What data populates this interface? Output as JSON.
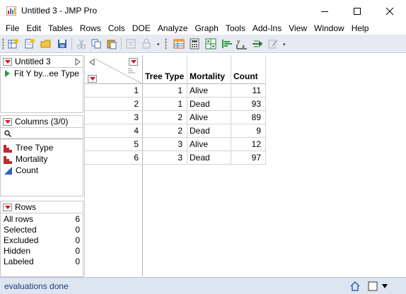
{
  "window": {
    "title": "Untitled 3 - JMP Pro"
  },
  "menu": [
    "File",
    "Edit",
    "Tables",
    "Rows",
    "Cols",
    "DOE",
    "Analyze",
    "Graph",
    "Tools",
    "Add-Ins",
    "View",
    "Window",
    "Help"
  ],
  "table_panel": {
    "title": "Untitled 3",
    "script": "Fit Y by...ee Type"
  },
  "columns_panel": {
    "title": "Columns (3/0)",
    "items": [
      {
        "label": "Tree Type",
        "icon": "nominal-bar-icon"
      },
      {
        "label": "Mortality",
        "icon": "nominal-bar-icon"
      },
      {
        "label": "Count",
        "icon": "continuous-triangle-icon"
      }
    ]
  },
  "rows_panel": {
    "title": "Rows",
    "items": [
      {
        "label": "All rows",
        "value": "6"
      },
      {
        "label": "Selected",
        "value": "0"
      },
      {
        "label": "Excluded",
        "value": "0"
      },
      {
        "label": "Hidden",
        "value": "0"
      },
      {
        "label": "Labeled",
        "value": "0"
      }
    ]
  },
  "grid": {
    "columns": [
      "Tree Type",
      "Mortality",
      "Count"
    ],
    "rows": [
      {
        "n": "1",
        "tree_type": "1",
        "mortality": "Alive",
        "count": "11"
      },
      {
        "n": "2",
        "tree_type": "1",
        "mortality": "Dead",
        "count": "93"
      },
      {
        "n": "3",
        "tree_type": "2",
        "mortality": "Alive",
        "count": "89"
      },
      {
        "n": "4",
        "tree_type": "2",
        "mortality": "Dead",
        "count": "9"
      },
      {
        "n": "5",
        "tree_type": "3",
        "mortality": "Alive",
        "count": "12"
      },
      {
        "n": "6",
        "tree_type": "3",
        "mortality": "Dead",
        "count": "97"
      }
    ]
  },
  "status": {
    "text": "evaluations done"
  },
  "colors": {
    "red_triangle": "#d71920",
    "script_green": "#2c9a3a",
    "status_bar": "#dde5f0",
    "toolbar": "#e7eaf0"
  }
}
